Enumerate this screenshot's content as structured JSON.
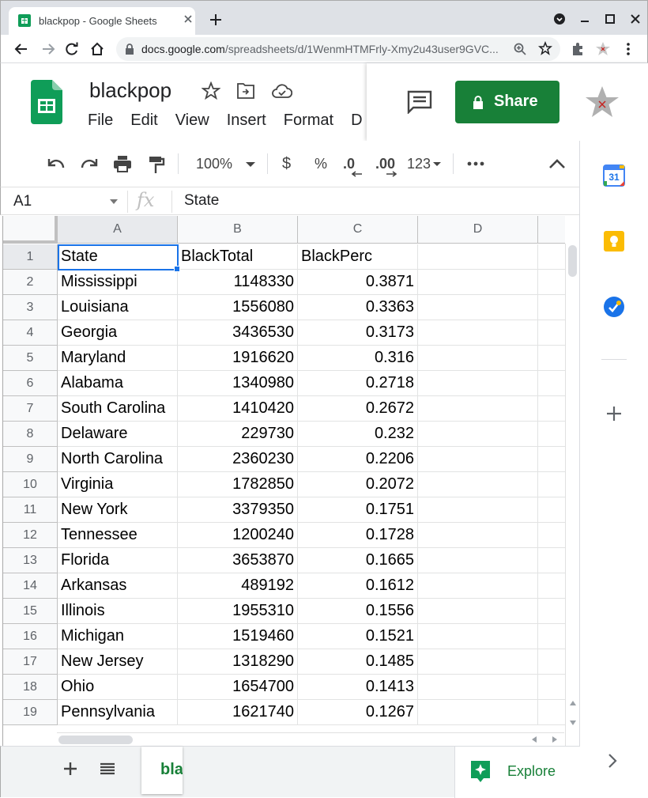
{
  "browser": {
    "tab_title": "blackpop - Google Sheets",
    "url_host": "docs.google.com",
    "url_path": "/spreadsheets/d/1WenmHTMFrly-Xmy2u43user9GVC..."
  },
  "doc": {
    "title": "blackpop",
    "menu": [
      "File",
      "Edit",
      "View",
      "Insert",
      "Format",
      "D"
    ],
    "share_label": "Share"
  },
  "toolbar": {
    "zoom": "100%",
    "currency": "$",
    "percent": "%",
    "dec_less": ".0",
    "dec_more": ".00",
    "number_format": "123"
  },
  "formula_bar": {
    "cell_ref": "A1",
    "fx": "fx",
    "value": "State"
  },
  "grid": {
    "columns": [
      "A",
      "B",
      "C",
      "D"
    ],
    "rows": [
      [
        "1",
        "State",
        "BlackTotal",
        "BlackPerc"
      ],
      [
        "2",
        "Mississippi",
        "1148330",
        "0.3871"
      ],
      [
        "3",
        "Louisiana",
        "1556080",
        "0.3363"
      ],
      [
        "4",
        "Georgia",
        "3436530",
        "0.3173"
      ],
      [
        "5",
        "Maryland",
        "1916620",
        "0.316"
      ],
      [
        "6",
        "Alabama",
        "1340980",
        "0.2718"
      ],
      [
        "7",
        "South Carolina",
        "1410420",
        "0.2672"
      ],
      [
        "8",
        "Delaware",
        "229730",
        "0.232"
      ],
      [
        "9",
        "North Carolina",
        "2360230",
        "0.2206"
      ],
      [
        "10",
        "Virginia",
        "1782850",
        "0.2072"
      ],
      [
        "11",
        "New York",
        "3379350",
        "0.1751"
      ],
      [
        "12",
        "Tennessee",
        "1200240",
        "0.1728"
      ],
      [
        "13",
        "Florida",
        "3653870",
        "0.1665"
      ],
      [
        "14",
        "Arkansas",
        "489192",
        "0.1612"
      ],
      [
        "15",
        "Illinois",
        "1955310",
        "0.1556"
      ],
      [
        "16",
        "Michigan",
        "1519460",
        "0.1521"
      ],
      [
        "17",
        "New Jersey",
        "1318290",
        "0.1485"
      ],
      [
        "18",
        "Ohio",
        "1654700",
        "0.1413"
      ],
      [
        "19",
        "Pennsylvania",
        "1621740",
        "0.1267"
      ]
    ]
  },
  "bottom": {
    "sheet_tab": "bla",
    "explore": "Explore"
  },
  "side": {
    "calendar_day": "31"
  },
  "colors": {
    "accent": "#188038",
    "selection": "#1a73e8"
  }
}
